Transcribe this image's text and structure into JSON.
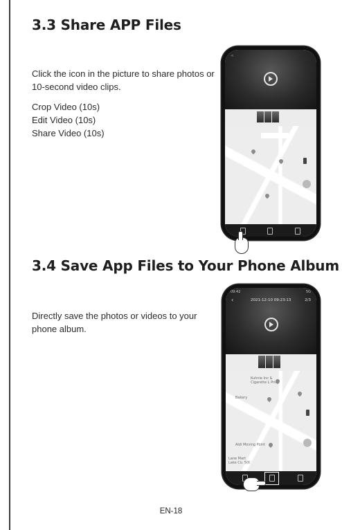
{
  "section_33": {
    "title": "3.3 Share APP Files",
    "description": "Click the icon in the picture to share photos or 10-second video clips.",
    "options": [
      "Crop Video (10s)",
      "Edit Video (10s)",
      "Share Video (10s)"
    ]
  },
  "section_34": {
    "title": "3.4 Save App Files to Your Phone Album",
    "description": "Directly save the photos or videos to  your phone album.",
    "phone_screen": {
      "status_left": "09:42",
      "status_right": "5G",
      "timestamp": "2021-12-10 09:23:13",
      "page_counter": "2/3",
      "map_labels": [
        "Kuhnie Inc &",
        "Cigarette L Pride",
        "Bakery",
        "Aldi Moving Point",
        "Lane Mart",
        "Lake Co. 50t"
      ]
    }
  },
  "footer": {
    "page_number": "EN-18"
  },
  "icons": {
    "play": "play-circle-icon",
    "share": "share-icon",
    "download": "download-icon",
    "delete": "trash-icon",
    "back": "chevron-left-icon",
    "hand": "pointing-hand-icon",
    "map_pin": "map-pin-icon"
  },
  "colors": {
    "text": "#1e1e1e",
    "phone_frame": "#101010",
    "map": "#ededed"
  }
}
